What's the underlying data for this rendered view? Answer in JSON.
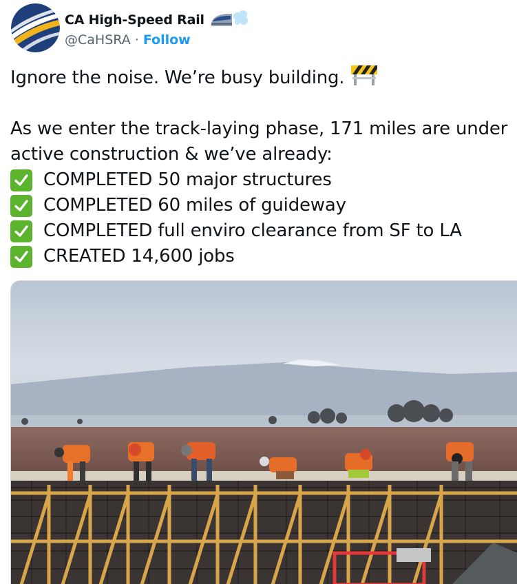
{
  "account": {
    "display_name": "CA High-Speed Rail",
    "handle": "@CaHSRA",
    "separator": "·",
    "follow_label": "Follow",
    "name_emoji": "train-and-dash-icon"
  },
  "tweet": {
    "intro": "Ignore the noise. We’re busy building.",
    "intro_emoji": "construction-barrier-icon",
    "line1": "As we enter the track-laying phase, 171 miles are under",
    "line2": "active construction & we’ve already:",
    "bullets": [
      "COMPLETED 50 major structures",
      "COMPLETED 60 miles of guideway",
      "COMPLETED full enviro clearance from SF to LA",
      "CREATED 14,600 jobs"
    ],
    "bullet_icon": "check-mark-button-icon"
  },
  "media": {
    "description_icon": "photo",
    "colors": {
      "sky": "#c9d5e2",
      "field": "#7a5a52",
      "rebar": "#2b2a2a",
      "timber": "#d9a54a"
    }
  },
  "colors": {
    "link": "#1d9bf0",
    "muted": "#536471",
    "check": "#5cb42e"
  }
}
